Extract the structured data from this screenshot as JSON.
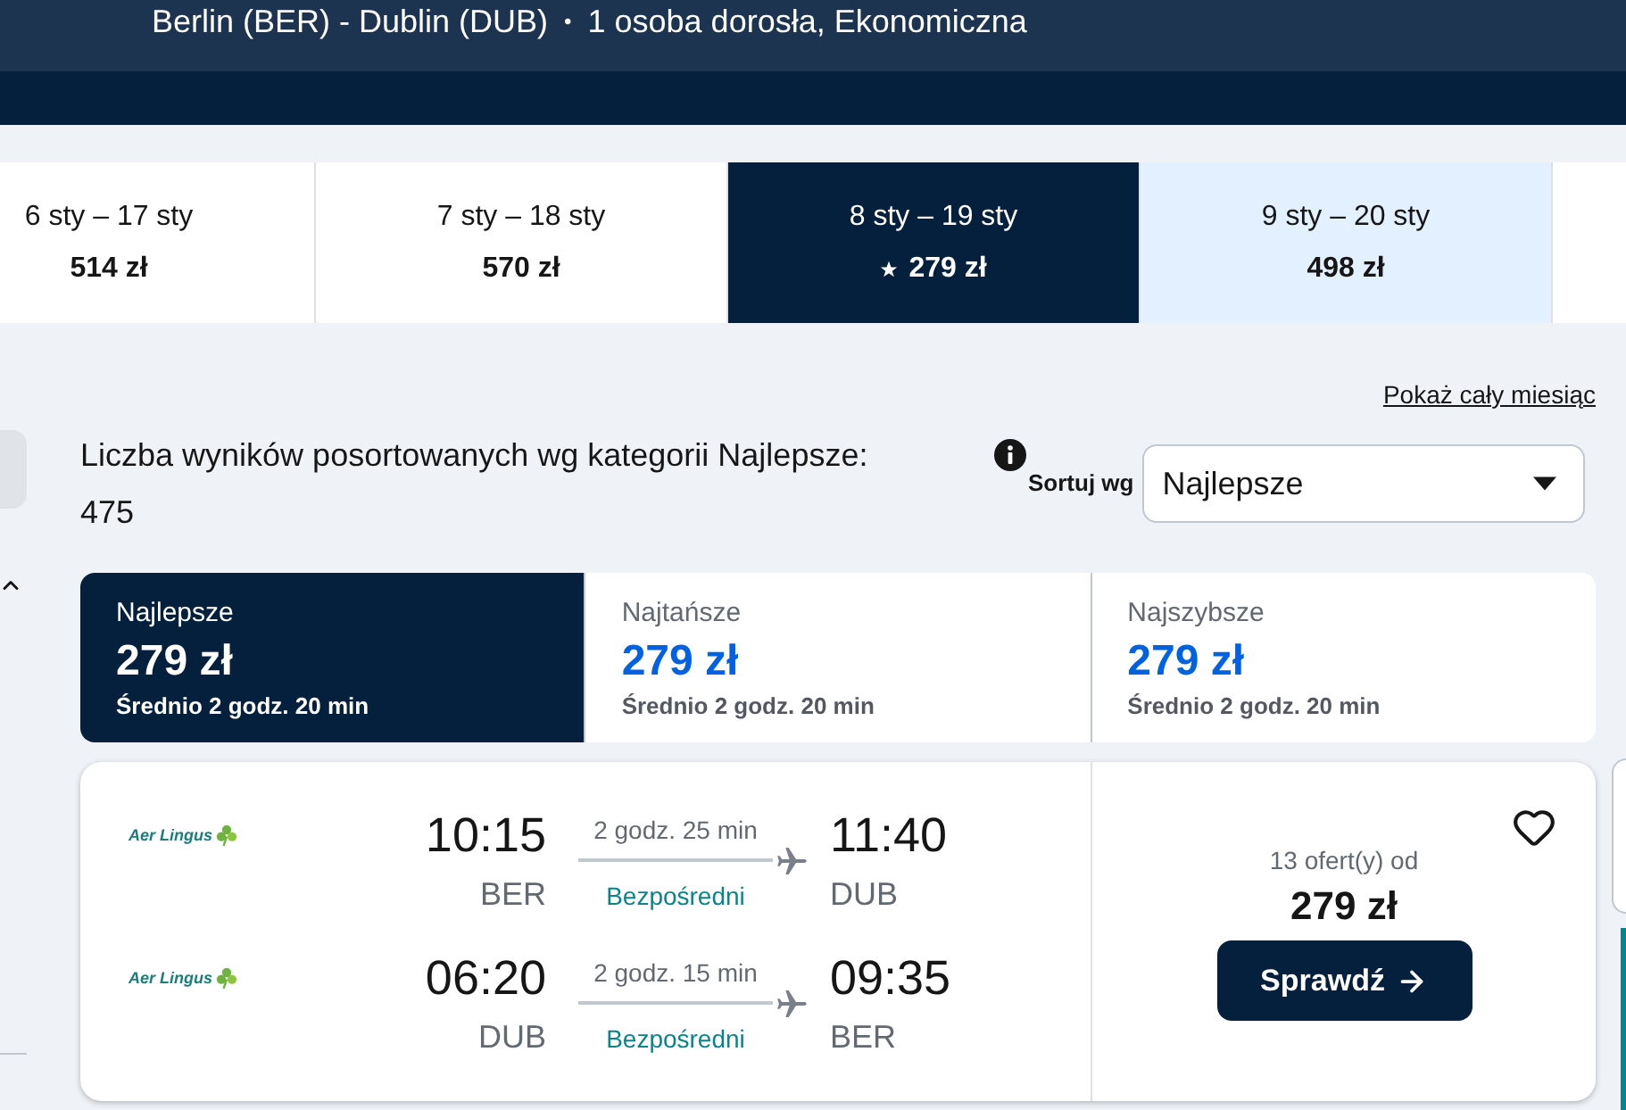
{
  "header": {
    "route": "Berlin (BER) - Dublin (DUB)",
    "separator": "•",
    "travellers": "1 osoba dorosła, Ekonomiczna"
  },
  "date_tabs": [
    {
      "dates": "6 sty – 17 sty",
      "price": "514 zł",
      "selected": false,
      "highlighted": false,
      "best": false
    },
    {
      "dates": "7 sty – 18 sty",
      "price": "570 zł",
      "selected": false,
      "highlighted": false,
      "best": false
    },
    {
      "dates": "8 sty – 19 sty",
      "price": "279 zł",
      "selected": true,
      "highlighted": false,
      "best": true
    },
    {
      "dates": "9 sty – 20 sty",
      "price": "498 zł",
      "selected": false,
      "highlighted": true,
      "best": false
    }
  ],
  "month_link": "Pokaż cały miesiąc",
  "results_summary": "Liczba wyników posortowanych wg kategorii Najlepsze: 475",
  "sort": {
    "label": "Sortuj wg",
    "value": "Najlepsze"
  },
  "sort_tabs": [
    {
      "label": "Najlepsze",
      "price": "279 zł",
      "average": "Średnio 2 godz. 20 min",
      "selected": true
    },
    {
      "label": "Najtańsze",
      "price": "279 zł",
      "average": "Średnio 2 godz. 20 min",
      "selected": false
    },
    {
      "label": "Najszybsze",
      "price": "279 zł",
      "average": "Średnio 2 godz. 20 min",
      "selected": false
    }
  ],
  "flights": [
    {
      "saved": false,
      "legs": [
        {
          "airline": "Aer Lingus",
          "depart_time": "10:15",
          "depart_airport": "BER",
          "duration": "2 godz. 25 min",
          "stops": "Bezpośredni",
          "arrive_time": "11:40",
          "arrive_airport": "DUB"
        },
        {
          "airline": "Aer Lingus",
          "depart_time": "06:20",
          "depart_airport": "DUB",
          "duration": "2 godz. 15 min",
          "stops": "Bezpośredni",
          "arrive_time": "09:35",
          "arrive_airport": "BER"
        }
      ],
      "offers": "13 ofert(y) od",
      "price": "279 zł",
      "button": "Sprawdź"
    }
  ]
}
